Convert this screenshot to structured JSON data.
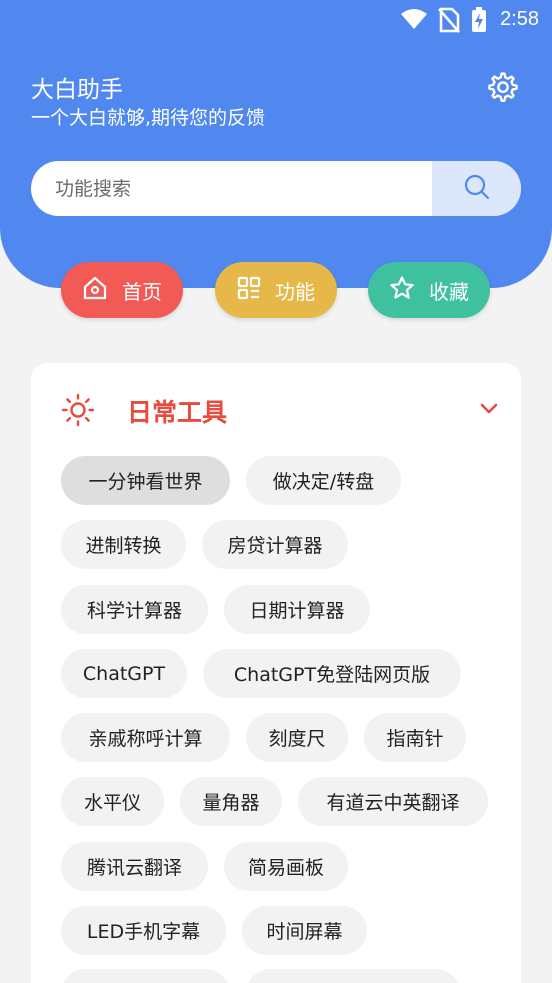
{
  "status_bar": {
    "time": "2:58"
  },
  "header": {
    "title": "大白助手",
    "subtitle": "一个大白就够,期待您的反馈"
  },
  "search": {
    "placeholder": "功能搜索",
    "value": ""
  },
  "nav": [
    {
      "label": "首页",
      "color": "#f25a55",
      "icon": "home-icon"
    },
    {
      "label": "功能",
      "color": "#e6b84a",
      "icon": "grid-icon"
    },
    {
      "label": "收藏",
      "color": "#3fc1a0",
      "icon": "star-icon"
    }
  ],
  "category": {
    "title": "日常工具",
    "icon": "sun-icon",
    "color": "#e94a3c",
    "expanded": true,
    "tools": [
      "一分钟看世界",
      "做决定/转盘",
      "进制转换",
      "房贷计算器",
      "科学计算器",
      "日期计算器",
      "ChatGPT",
      "ChatGPT免登陆网页版",
      "亲戚称呼计算",
      "刻度尺",
      "指南针",
      "水平仪",
      "量角器",
      "有道云中英翻译",
      "腾讯云翻译",
      "简易画板",
      "LED手机字幕",
      "时间屏幕"
    ],
    "selected_tool": "一分钟看世界"
  },
  "colors": {
    "header_bg": "#5088f0",
    "page_bg": "#f3f3f3",
    "accent": "#5088f0"
  }
}
